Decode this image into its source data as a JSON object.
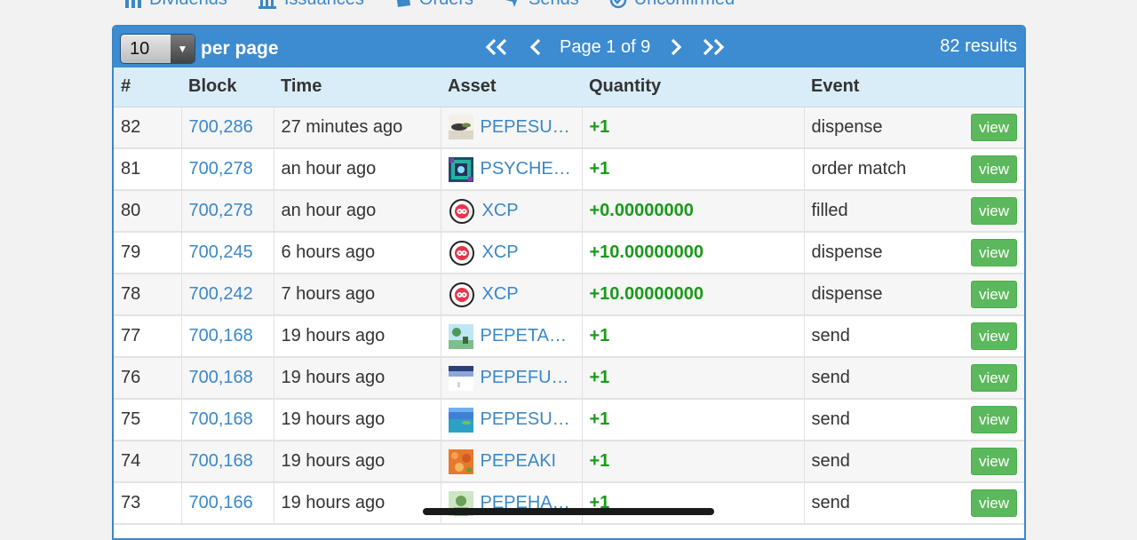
{
  "nav": [
    {
      "label": "Dividends",
      "icon": "dividends-icon"
    },
    {
      "label": "Issuances",
      "icon": "issuances-icon"
    },
    {
      "label": "Orders",
      "icon": "orders-icon"
    },
    {
      "label": "Sends",
      "icon": "sends-icon"
    },
    {
      "label": "Unconfirmed",
      "icon": "unconfirmed-icon"
    }
  ],
  "toolbar": {
    "per_page_value": "10",
    "per_page_label": "per page",
    "page_text": "Page 1 of 9",
    "results_text": "82 results"
  },
  "columns": [
    "#",
    "Block",
    "Time",
    "Asset",
    "Quantity",
    "Event"
  ],
  "rows": [
    {
      "num": "82",
      "block": "700,286",
      "time": "27 minutes ago",
      "asset": "PEPESU…",
      "asset_icon": "pepe-sunset-thumb",
      "qty": "+1",
      "event": "dispense",
      "action": "view"
    },
    {
      "num": "81",
      "block": "700,278",
      "time": "an hour ago",
      "asset": "PSYCHE…",
      "asset_icon": "psychedelic-thumb",
      "qty": "+1",
      "event": "order match",
      "action": "view"
    },
    {
      "num": "80",
      "block": "700,278",
      "time": "an hour ago",
      "asset": "XCP",
      "asset_icon": "xcp-icon",
      "qty": "+0.00000000",
      "event": "filled",
      "action": "view"
    },
    {
      "num": "79",
      "block": "700,245",
      "time": "6 hours ago",
      "asset": "XCP",
      "asset_icon": "xcp-icon",
      "qty": "+10.00000000",
      "event": "dispense",
      "action": "view"
    },
    {
      "num": "78",
      "block": "700,242",
      "time": "7 hours ago",
      "asset": "XCP",
      "asset_icon": "xcp-icon",
      "qty": "+10.00000000",
      "event": "dispense",
      "action": "view"
    },
    {
      "num": "77",
      "block": "700,168",
      "time": "19 hours ago",
      "asset": "PEPETARO",
      "asset_icon": "pepetaro-thumb",
      "qty": "+1",
      "event": "send",
      "action": "view"
    },
    {
      "num": "76",
      "block": "700,168",
      "time": "19 hours ago",
      "asset": "PEPEFUYU",
      "asset_icon": "pepefuyu-thumb",
      "qty": "+1",
      "event": "send",
      "action": "view"
    },
    {
      "num": "75",
      "block": "700,168",
      "time": "19 hours ago",
      "asset": "PEPESU…",
      "asset_icon": "pepe-summer-thumb",
      "qty": "+1",
      "event": "send",
      "action": "view"
    },
    {
      "num": "74",
      "block": "700,168",
      "time": "19 hours ago",
      "asset": "PEPEAKI",
      "asset_icon": "pepeaki-thumb",
      "qty": "+1",
      "event": "send",
      "action": "view"
    },
    {
      "num": "73",
      "block": "700,166",
      "time": "19 hours ago",
      "asset": "PEPEHARU",
      "asset_icon": "pepeharu-thumb",
      "qty": "+1",
      "event": "send",
      "action": "view"
    }
  ],
  "colors": {
    "header_blue": "#3d8bd0",
    "link_blue": "#3c87c6",
    "qty_green": "#1a9a1a",
    "view_green": "#5cb85c",
    "th_bg": "#d9edf8"
  }
}
